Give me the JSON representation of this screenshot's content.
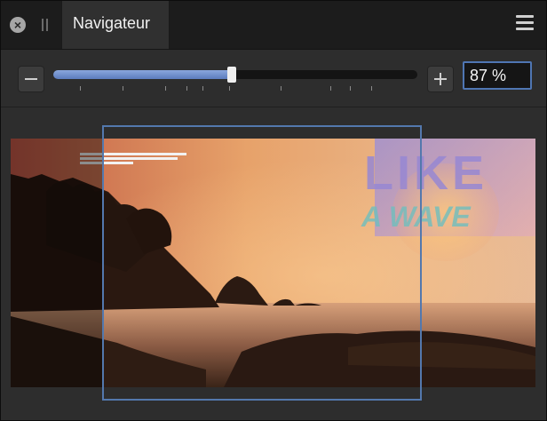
{
  "panel": {
    "title": "Navigateur"
  },
  "zoom": {
    "value": "87 %",
    "slider_fraction": 0.49
  },
  "preview": {
    "artwork_line1": "LIKE",
    "artwork_line2_prefix": "A",
    "artwork_line2": "WAVE"
  },
  "colors": {
    "accent": "#5378ad",
    "slider_fill": "#7393d0",
    "header_bg": "#1c1c1c",
    "panel_bg": "#2d2d2d"
  },
  "icons": {
    "close": "close-icon",
    "grip": "drag-grip-icon",
    "menu": "hamburger-menu-icon",
    "zoom_out": "minus-icon",
    "zoom_in": "plus-icon"
  }
}
